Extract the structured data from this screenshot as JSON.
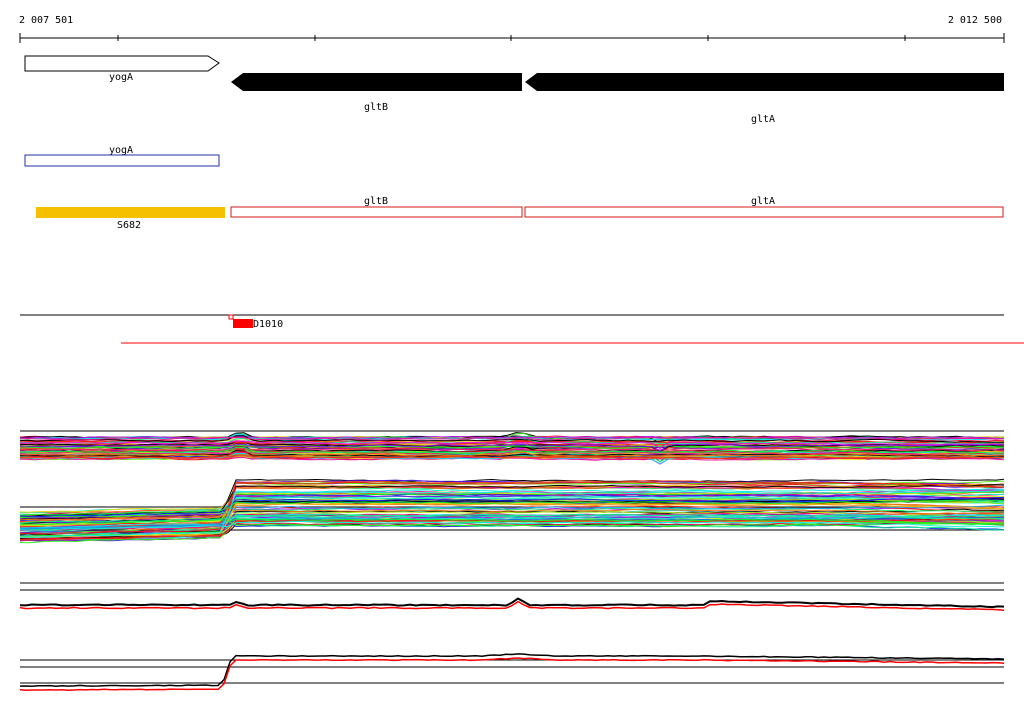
{
  "ruler": {
    "start_label": "2 007 501",
    "end_label": "2 012 500",
    "start": 2007501,
    "end": 2012500
  },
  "colors": {
    "forward_gene_stroke": "#000000",
    "reverse_gene_fill": "#000000",
    "cds_forward": "#1f2fa8",
    "cds_reverse": "#d01818",
    "segment": "#f5c000",
    "feature_red": "#ff0000"
  },
  "genes": [
    {
      "name": "yogA",
      "strand": "forward",
      "start": 2007525,
      "end": 2008522
    },
    {
      "name": "gltB",
      "strand": "reverse",
      "start": 2008560,
      "end": 2010045
    },
    {
      "name": "gltA",
      "strand": "reverse",
      "start": 2010062,
      "end": 2012500
    }
  ],
  "cds": [
    {
      "name": "yogA",
      "strand": "forward",
      "start": 2007525,
      "end": 2008522
    },
    {
      "name": "gltB",
      "strand": "reverse",
      "start": 2008560,
      "end": 2010045
    },
    {
      "name": "gltA",
      "strand": "reverse",
      "start": 2010062,
      "end": 2012500
    }
  ],
  "segments": [
    {
      "name": "S682",
      "start": 2007580,
      "end": 2008528
    }
  ],
  "features": [
    {
      "name": "D1010",
      "start": 2008565,
      "end": 2008680
    }
  ]
}
